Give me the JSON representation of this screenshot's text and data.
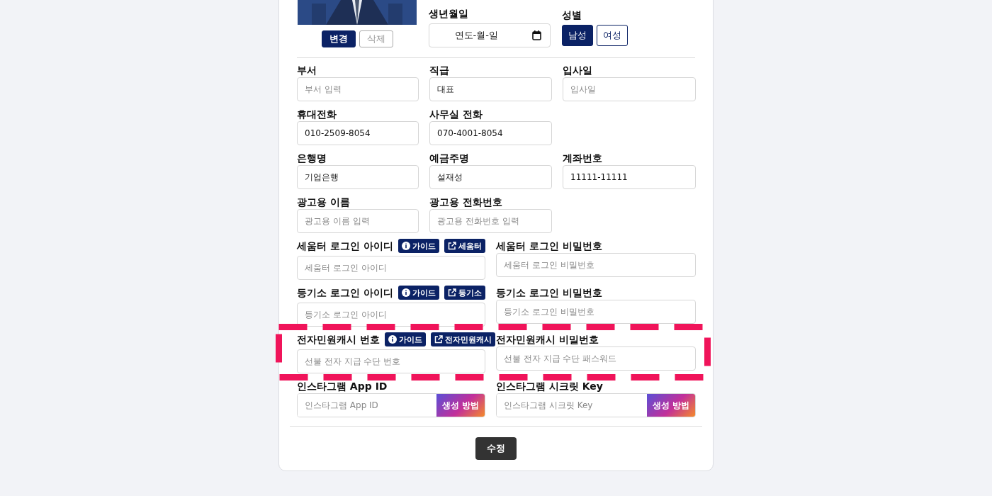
{
  "profile": {
    "buttons": [
      {
        "label": "변경",
        "kind": "primary"
      },
      {
        "label": "삭제",
        "kind": "secondary"
      }
    ]
  },
  "birth": {
    "label": "생년월일",
    "value": "연도-월-일"
  },
  "gender": {
    "label": "성별",
    "options": [
      {
        "label": "남성",
        "selected": true
      },
      {
        "label": "여성",
        "selected": false
      }
    ]
  },
  "rows": [
    {
      "kind": "three-column",
      "highlighted": false,
      "fields": [
        {
          "label": "부서",
          "placeholder": "부서 입력"
        },
        {
          "label": "직급",
          "value": "대표"
        },
        {
          "label": "입사일",
          "placeholder": "입사일"
        }
      ]
    },
    {
      "kind": "three-column",
      "highlighted": false,
      "fields": [
        {
          "label": "휴대전화",
          "value": "010-2509-8054"
        },
        {
          "label": "사무실 전화",
          "value": "070-4001-8054"
        }
      ]
    },
    {
      "kind": "three-column",
      "highlighted": false,
      "fields": [
        {
          "label": "은행명",
          "value": "기업은행"
        },
        {
          "label": "예금주명",
          "value": "설재성"
        },
        {
          "label": "계좌번호",
          "value": "11111-11111"
        }
      ]
    },
    {
      "kind": "three-column",
      "highlighted": false,
      "fields": [
        {
          "label": "광고용 이름",
          "placeholder": "광고용 이름 입력"
        },
        {
          "label": "광고용 전화번호",
          "placeholder": "광고용 전화번호 입력"
        }
      ]
    },
    {
      "kind": "two-column",
      "highlighted": false,
      "fields": [
        {
          "label": "세움터 로그인 아이디",
          "placeholder": "세움터 로그인 아이디",
          "links": [
            {
              "kind": "guide",
              "label": "가이드"
            },
            {
              "kind": "external",
              "label": "세움터"
            }
          ]
        },
        {
          "label": "세움터 로그인 비밀번호",
          "placeholder": "세움터 로그인 비밀번호"
        }
      ]
    },
    {
      "kind": "two-column",
      "highlighted": false,
      "fields": [
        {
          "label": "등기소 로그인 아이디",
          "placeholder": "등기소 로그인 아이디",
          "links": [
            {
              "kind": "guide",
              "label": "가이드"
            },
            {
              "kind": "external",
              "label": "등기소"
            }
          ]
        },
        {
          "label": "등기소 로그인 비밀번호",
          "placeholder": "등기소 로그인 비밀번호"
        }
      ]
    },
    {
      "kind": "two-column",
      "highlighted": true,
      "fields": [
        {
          "label": "전자민원캐시 번호",
          "placeholder": "선불 전자 지급 수단 번호",
          "links": [
            {
              "kind": "guide",
              "label": "가이드"
            },
            {
              "kind": "external",
              "label": "전자민원캐시"
            }
          ]
        },
        {
          "label": "전자민원캐시 비밀번호",
          "placeholder": "선불 전자 지급 수단 패스워드"
        }
      ]
    },
    {
      "kind": "two-column",
      "highlighted": false,
      "fields": [
        {
          "label": "인스타그램 App ID",
          "placeholder": "인스타그램 App ID",
          "addon": "생성 방법"
        },
        {
          "label": "인스타그램 시크릿 Key",
          "placeholder": "인스타그램 시크릿 Key",
          "addon": "생성 방법"
        }
      ]
    }
  ],
  "submit": "수정"
}
